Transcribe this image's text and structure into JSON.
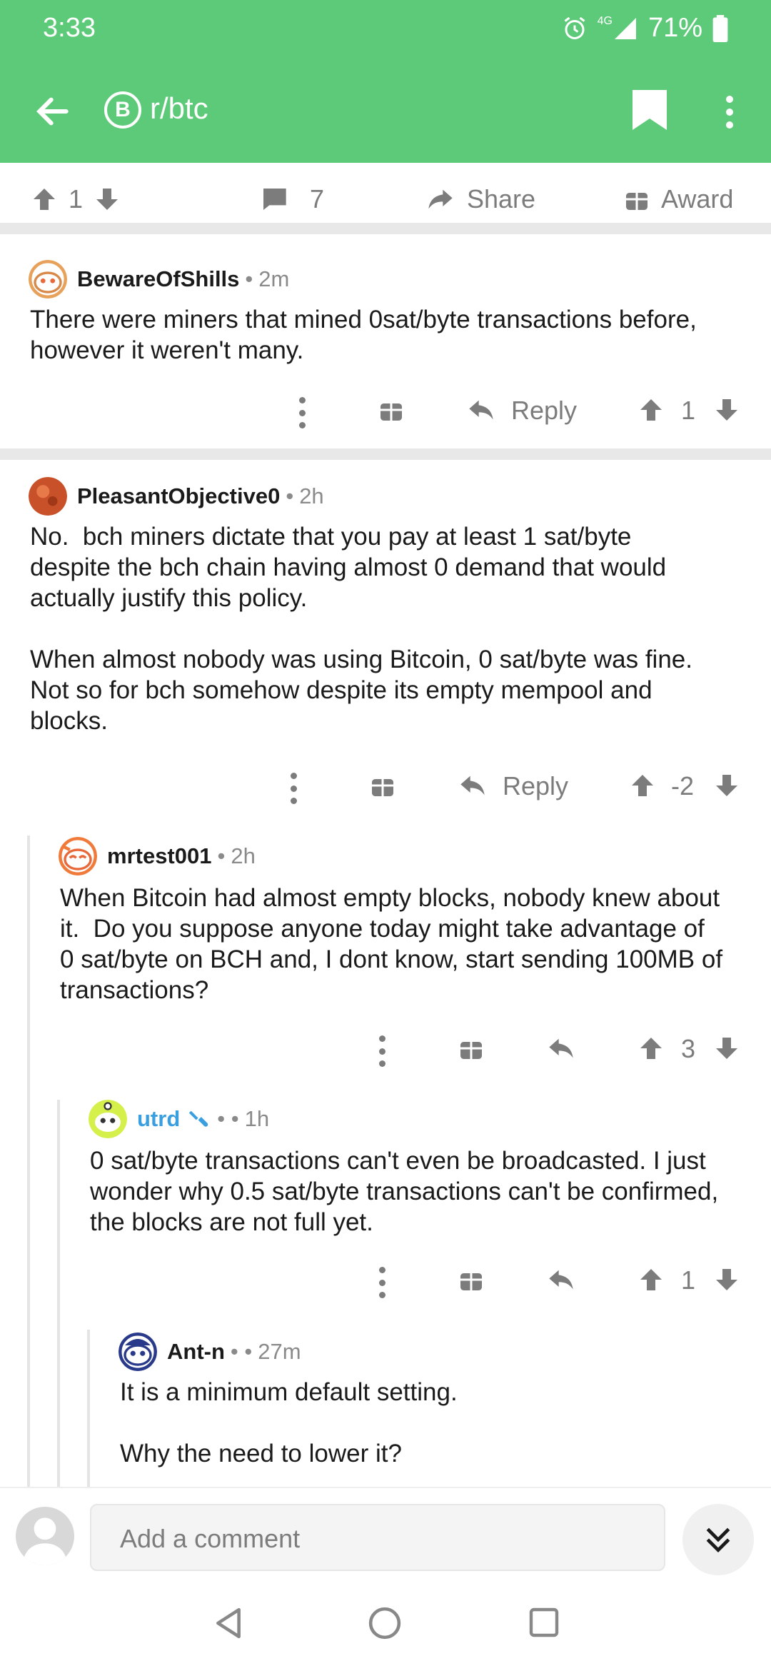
{
  "status_bar": {
    "time": "3:33",
    "network": "4G",
    "battery": "71%"
  },
  "nav": {
    "subreddit": "r/btc",
    "sub_icon_letter": "B"
  },
  "post_actions": {
    "score": "1",
    "comments": "7",
    "share": "Share",
    "award": "Award"
  },
  "comments": [
    {
      "author": "BewareOfShills",
      "age": "2m",
      "body": "There were miners that mined 0sat/byte transactions before,\nhowever it weren't many.",
      "reply": "Reply",
      "score": "1"
    },
    {
      "author": "PleasantObjective0",
      "age": "2h",
      "body": "No.  bch miners dictate that you pay at least 1 sat/byte\ndespite the bch chain having almost 0 demand that would\nactually justify this policy.\n\nWhen almost nobody was using Bitcoin, 0 sat/byte was fine.\nNot so for bch somehow despite its empty mempool and\nblocks.",
      "reply": "Reply",
      "score": "-2"
    },
    {
      "author": "mrtest001",
      "age": "2h",
      "body": "When Bitcoin had almost empty blocks, nobody knew about\nit.  Do you suppose anyone today might take advantage of\n0 sat/byte on BCH and, I dont know, start sending 100MB of\ntransactions?",
      "score": "3"
    },
    {
      "author": "utrd",
      "age": "1h",
      "body": "0 sat/byte transactions can't even be broadcasted. I just\nwonder why 0.5 sat/byte transactions can't be confirmed,\nthe blocks are not full yet.",
      "score": "1"
    },
    {
      "author": "Ant-n",
      "age": "27m",
      "body": "It is a minimum default setting.\n\nWhy the need to lower it?"
    }
  ],
  "composer": {
    "placeholder": "Add a comment"
  },
  "colors": {
    "header": "#5cca78",
    "icon_grey": "#7c7c7c",
    "username_blue": "#3a9fe0"
  }
}
